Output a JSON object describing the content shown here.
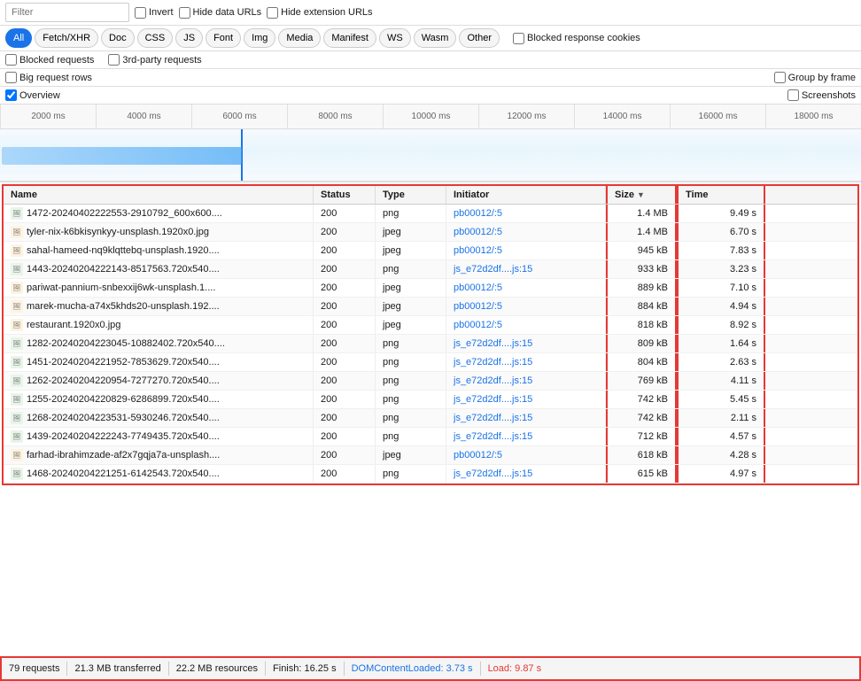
{
  "filter": {
    "placeholder": "Filter",
    "invert_label": "Invert",
    "hide_data_urls_label": "Hide data URLs",
    "hide_extension_urls_label": "Hide extension URLs"
  },
  "type_buttons": [
    {
      "id": "all",
      "label": "All",
      "active": true
    },
    {
      "id": "fetch_xhr",
      "label": "Fetch/XHR",
      "active": false
    },
    {
      "id": "doc",
      "label": "Doc",
      "active": false
    },
    {
      "id": "css",
      "label": "CSS",
      "active": false
    },
    {
      "id": "js",
      "label": "JS",
      "active": false
    },
    {
      "id": "font",
      "label": "Font",
      "active": false
    },
    {
      "id": "img",
      "label": "Img",
      "active": false
    },
    {
      "id": "media",
      "label": "Media",
      "active": false
    },
    {
      "id": "manifest",
      "label": "Manifest",
      "active": false
    },
    {
      "id": "ws",
      "label": "WS",
      "active": false
    },
    {
      "id": "wasm",
      "label": "Wasm",
      "active": false
    },
    {
      "id": "other",
      "label": "Other",
      "active": false
    }
  ],
  "options": {
    "blocked_response_cookies": "Blocked response cookies",
    "blocked_requests": "Blocked requests",
    "third_party": "3rd-party requests",
    "big_request_rows": "Big request rows",
    "group_by_frame": "Group by frame",
    "overview": "Overview",
    "screenshots": "Screenshots"
  },
  "timeline": {
    "ticks": [
      "2000 ms",
      "4000 ms",
      "6000 ms",
      "8000 ms",
      "10000 ms",
      "12000 ms",
      "14000 ms",
      "16000 ms",
      "18000 ms"
    ]
  },
  "table": {
    "headers": {
      "name": "Name",
      "status": "Status",
      "type": "Type",
      "initiator": "Initiator",
      "size": "Size",
      "time": "Time"
    },
    "rows": [
      {
        "name": "1472-20240402222553-2910792_600x600....",
        "status": "200",
        "type": "png",
        "initiator": "pb00012/:5",
        "size": "1.4 MB",
        "time": "9.49 s"
      },
      {
        "name": "tyler-nix-k6bkisynkyy-unsplash.1920x0.jpg",
        "status": "200",
        "type": "jpeg",
        "initiator": "pb00012/:5",
        "size": "1.4 MB",
        "time": "6.70 s"
      },
      {
        "name": "sahal-hameed-nq9klqttebq-unsplash.1920....",
        "status": "200",
        "type": "jpeg",
        "initiator": "pb00012/:5",
        "size": "945 kB",
        "time": "7.83 s"
      },
      {
        "name": "1443-20240204222143-8517563.720x540....",
        "status": "200",
        "type": "png",
        "initiator": "js_e72d2df....js:15",
        "size": "933 kB",
        "time": "3.23 s"
      },
      {
        "name": "pariwat-pannium-snbexxij6wk-unsplash.1....",
        "status": "200",
        "type": "jpeg",
        "initiator": "pb00012/:5",
        "size": "889 kB",
        "time": "7.10 s"
      },
      {
        "name": "marek-mucha-a74x5khds20-unsplash.192....",
        "status": "200",
        "type": "jpeg",
        "initiator": "pb00012/:5",
        "size": "884 kB",
        "time": "4.94 s"
      },
      {
        "name": "restaurant.1920x0.jpg",
        "status": "200",
        "type": "jpeg",
        "initiator": "pb00012/:5",
        "size": "818 kB",
        "time": "8.92 s"
      },
      {
        "name": "1282-20240204223045-10882402.720x540....",
        "status": "200",
        "type": "png",
        "initiator": "js_e72d2df....js:15",
        "size": "809 kB",
        "time": "1.64 s"
      },
      {
        "name": "1451-20240204221952-7853629.720x540....",
        "status": "200",
        "type": "png",
        "initiator": "js_e72d2df....js:15",
        "size": "804 kB",
        "time": "2.63 s"
      },
      {
        "name": "1262-20240204220954-7277270.720x540....",
        "status": "200",
        "type": "png",
        "initiator": "js_e72d2df....js:15",
        "size": "769 kB",
        "time": "4.11 s"
      },
      {
        "name": "1255-20240204220829-6286899.720x540....",
        "status": "200",
        "type": "png",
        "initiator": "js_e72d2df....js:15",
        "size": "742 kB",
        "time": "5.45 s"
      },
      {
        "name": "1268-20240204223531-5930246.720x540....",
        "status": "200",
        "type": "png",
        "initiator": "js_e72d2df....js:15",
        "size": "742 kB",
        "time": "2.11 s"
      },
      {
        "name": "1439-20240204222243-7749435.720x540....",
        "status": "200",
        "type": "png",
        "initiator": "js_e72d2df....js:15",
        "size": "712 kB",
        "time": "4.57 s"
      },
      {
        "name": "farhad-ibrahimzade-af2x7gqja7a-unsplash....",
        "status": "200",
        "type": "jpeg",
        "initiator": "pb00012/:5",
        "size": "618 kB",
        "time": "4.28 s"
      },
      {
        "name": "1468-20240204221251-6142543.720x540....",
        "status": "200",
        "type": "png",
        "initiator": "js_e72d2df....js:15",
        "size": "615 kB",
        "time": "4.97 s"
      }
    ]
  },
  "status_bar": {
    "requests": "79 requests",
    "transferred": "21.3 MB transferred",
    "resources": "22.2 MB resources",
    "finish": "Finish: 16.25 s",
    "dom_loaded": "DOMContentLoaded: 3.73 s",
    "load": "Load: 9.87 s"
  }
}
